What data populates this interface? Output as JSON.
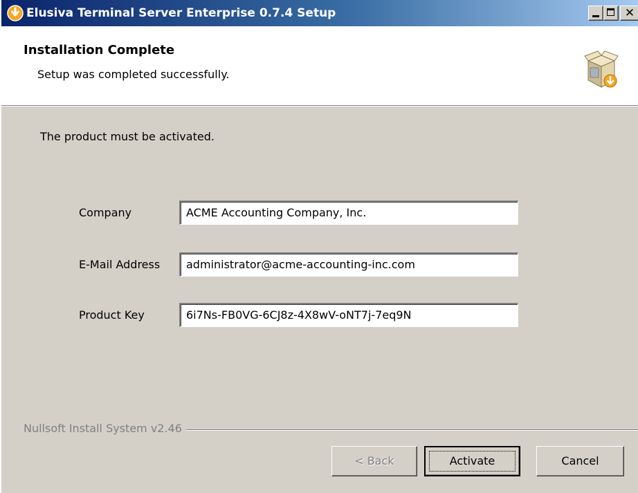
{
  "window": {
    "title": "Elusiva Terminal Server Enterprise 0.7.4 Setup",
    "controls": {
      "minimize": "minimize-icon",
      "maximize": "maximize-icon",
      "close": "✕"
    }
  },
  "header": {
    "title": "Installation Complete",
    "subtitle": "Setup was completed successfully.",
    "icon": "installer-box-icon"
  },
  "body": {
    "intro": "The product must be activated.",
    "fields": [
      {
        "label": "Company",
        "value": "ACME Accounting Company, Inc."
      },
      {
        "label": "E-Mail Address",
        "value": "administrator@acme-accounting-inc.com"
      },
      {
        "label": "Product Key",
        "value": "6i7Ns-FB0VG-6CJ8z-4X8wV-oNT7j-7eq9N"
      }
    ]
  },
  "footer": {
    "branding": "Nullsoft Install System v2.46",
    "buttons": {
      "back": "< Back",
      "activate": "Activate",
      "cancel": "Cancel"
    }
  },
  "colors": {
    "face": "#d4d0c8",
    "title_start": "#0a246a",
    "title_end": "#a6caf0",
    "disabled_text": "#808080"
  }
}
